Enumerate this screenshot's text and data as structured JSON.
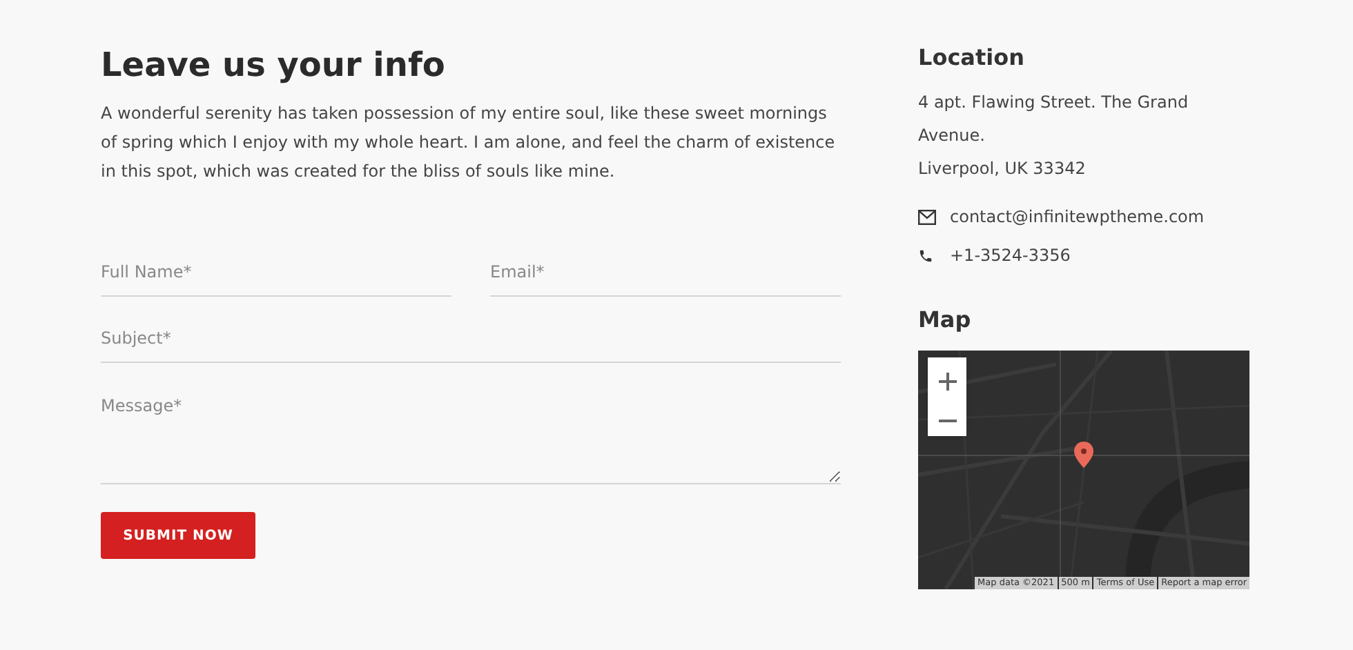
{
  "form": {
    "title": "Leave us your info",
    "intro": "A wonderful serenity has taken possession of my entire soul, like these sweet mornings of spring which I enjoy with my whole heart. I am alone, and feel the charm of existence in this spot, which was created for the bliss of souls like mine.",
    "fields": [
      {
        "kind": "input",
        "placeholder": "Full Name*"
      },
      {
        "kind": "input",
        "placeholder": "Email*"
      },
      {
        "kind": "input",
        "placeholder": "Subject*"
      },
      {
        "kind": "textarea",
        "placeholder": "Message*"
      }
    ],
    "submit": "SUBMIT NOW"
  },
  "location": {
    "title": "Location",
    "address": [
      "4 apt. Flawing Street. The Grand Avenue.",
      "Liverpool, UK 33342"
    ],
    "contacts": [
      {
        "kind": "email",
        "text": "contact@infinitewptheme.com"
      },
      {
        "kind": "phone",
        "text": "+1-3524-3356"
      }
    ]
  },
  "map": {
    "title": "Map",
    "attribution": [
      "Map data ©2021",
      "500 m",
      "Terms of Use",
      "Report a map error"
    ]
  }
}
